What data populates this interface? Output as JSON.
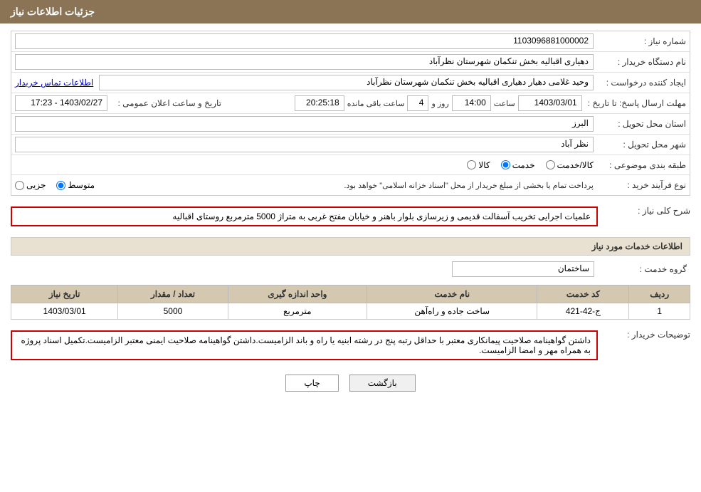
{
  "header": {
    "title": "جزئیات اطلاعات نیاز"
  },
  "form": {
    "need_number_label": "شماره نیاز :",
    "need_number_value": "1103096881000002",
    "buyer_org_label": "نام دستگاه خریدار :",
    "buyer_org_value": "دهیاری اقبالیه بخش تنکمان شهرستان نظرآباد",
    "creator_label": "ایجاد کننده درخواست :",
    "creator_value": "وحید غلامی دهیار دهیاری اقبالیه بخش تنکمان شهرستان نظرآباد",
    "contact_link": "اطلاعات تماس خریدار",
    "deadline_label": "مهلت ارسال پاسخ: تا تاریخ :",
    "deadline_date": "1403/03/01",
    "deadline_time_label": "ساعت",
    "deadline_time": "14:00",
    "deadline_days_label": "روز و",
    "deadline_days": "4",
    "deadline_remaining_label": "ساعت باقی مانده",
    "deadline_remaining": "20:25:18",
    "announcement_label": "تاریخ و ساعت اعلان عمومی :",
    "announcement_value": "1403/02/27 - 17:23",
    "province_label": "استان محل تحویل :",
    "province_value": "البرز",
    "city_label": "شهر محل تحویل :",
    "city_value": "نظر آباد",
    "category_label": "طبقه بندی موضوعی :",
    "category_options": [
      {
        "id": "kala",
        "label": "کالا"
      },
      {
        "id": "khadamat",
        "label": "خدمت"
      },
      {
        "id": "kala_khadamat",
        "label": "کالا/خدمت"
      }
    ],
    "category_selected": "khadamat",
    "purchase_type_label": "نوع فرآیند خرید :",
    "purchase_options": [
      {
        "id": "jazii",
        "label": "جزیی"
      },
      {
        "id": "motovaset",
        "label": "متوسط"
      },
      {
        "id": "description",
        "label": "پرداخت تمام یا بخشی از مبلغ خریدار از محل \"اسناد خزانه اسلامی\" خواهد بود."
      }
    ],
    "purchase_selected": "motovaset",
    "description_label": "شرح کلی نیاز :",
    "description_value": "علمیات اجرایی تخریب آسفالت قدیمی و زیرسازی بلوار باهنر و خیابان مفتح غربی به متراژ 5000 مترمربع روستای اقبالیه",
    "services_section_title": "اطلاعات خدمات مورد نیاز",
    "service_group_label": "گروه خدمت :",
    "service_group_value": "ساختمان",
    "table_headers": {
      "row_num": "ردیف",
      "service_code": "کد خدمت",
      "service_name": "نام خدمت",
      "unit": "واحد اندازه گیری",
      "quantity": "تعداد / مقدار",
      "need_date": "تاریخ نیاز"
    },
    "table_rows": [
      {
        "row_num": "1",
        "service_code": "ج-42-421",
        "service_name": "ساخت جاده و راه‌آهن",
        "unit": "مترمربع",
        "quantity": "5000",
        "need_date": "1403/03/01"
      }
    ],
    "buyer_notes_label": "توضیحات خریدار :",
    "buyer_notes_value": "داشتن گواهینامه صلاحیت پیمانکاری معتبر با حداقل رتبه پنج در رشته ابنیه یا راه و باند الزامیست.داشتن گواهینامه صلاحیت ایمنی معتبر الزامیست.تکمیل اسناد پروژه به همراه مهر و امضا الزامیست.",
    "btn_back": "بازگشت",
    "btn_print": "چاپ"
  }
}
